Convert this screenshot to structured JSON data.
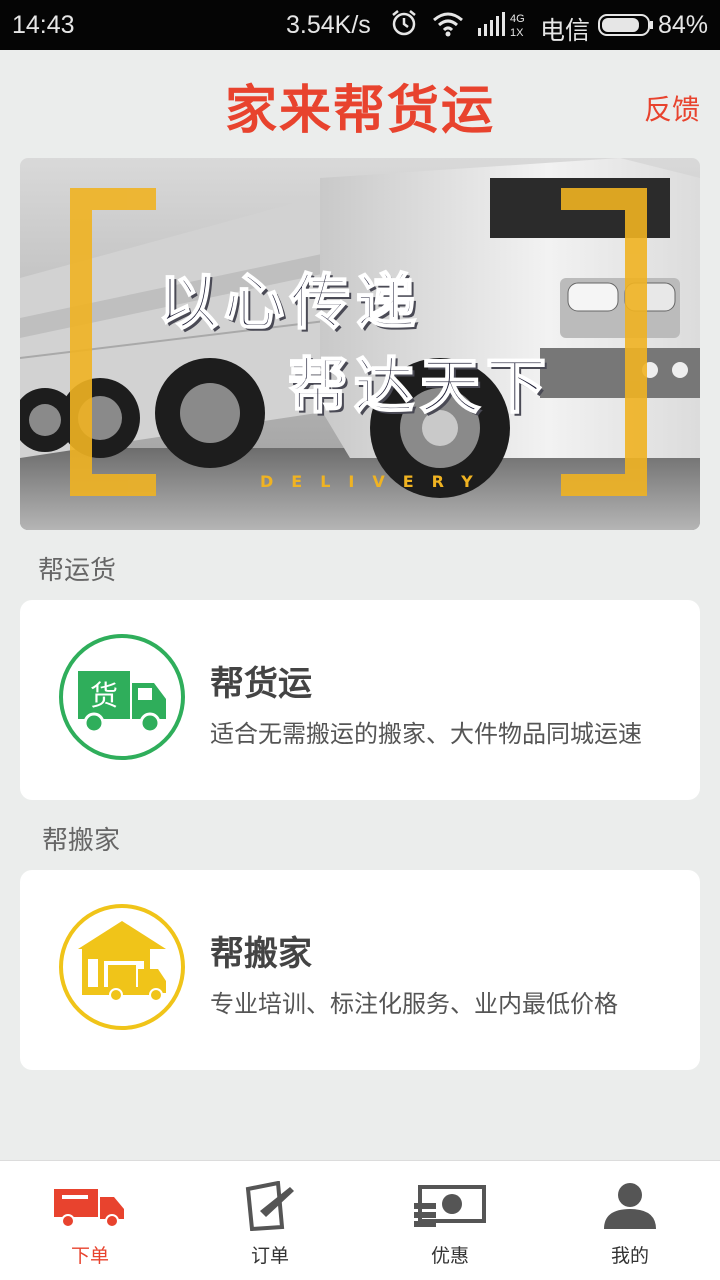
{
  "status_bar": {
    "time": "14:43",
    "speed": "3.54K/s",
    "carrier": "电信",
    "battery": "84%",
    "network_top": "4G",
    "network_bottom": "1X",
    "battery_level": 0.84
  },
  "header": {
    "title": "家来帮货运",
    "feedback": "反馈"
  },
  "banner": {
    "line1": "以心传递",
    "line2": "帮达天下",
    "subtitle": "DELIVERY"
  },
  "sections": [
    {
      "title": "帮运货",
      "card": {
        "title": "帮货运",
        "description": "适合无需搬运的搬家、大件物品同城运速",
        "icon": "freight-truck-icon",
        "icon_badge": "货",
        "color": "#2fae5b"
      }
    },
    {
      "title": "帮搬家",
      "card": {
        "title": "帮搬家",
        "description": "专业培训、标注化服务、业内最低价格",
        "icon": "house-moving-icon",
        "color": "#f0c419"
      }
    }
  ],
  "bottom_nav": [
    {
      "label": "下单",
      "icon": "truck-icon",
      "active": true
    },
    {
      "label": "订单",
      "icon": "order-edit-icon",
      "active": false
    },
    {
      "label": "优惠",
      "icon": "money-icon",
      "active": false
    },
    {
      "label": "我的",
      "icon": "user-icon",
      "active": false
    }
  ],
  "colors": {
    "accent": "#e8432e",
    "banner_bracket": "#f0b322",
    "background": "#ebedec"
  }
}
